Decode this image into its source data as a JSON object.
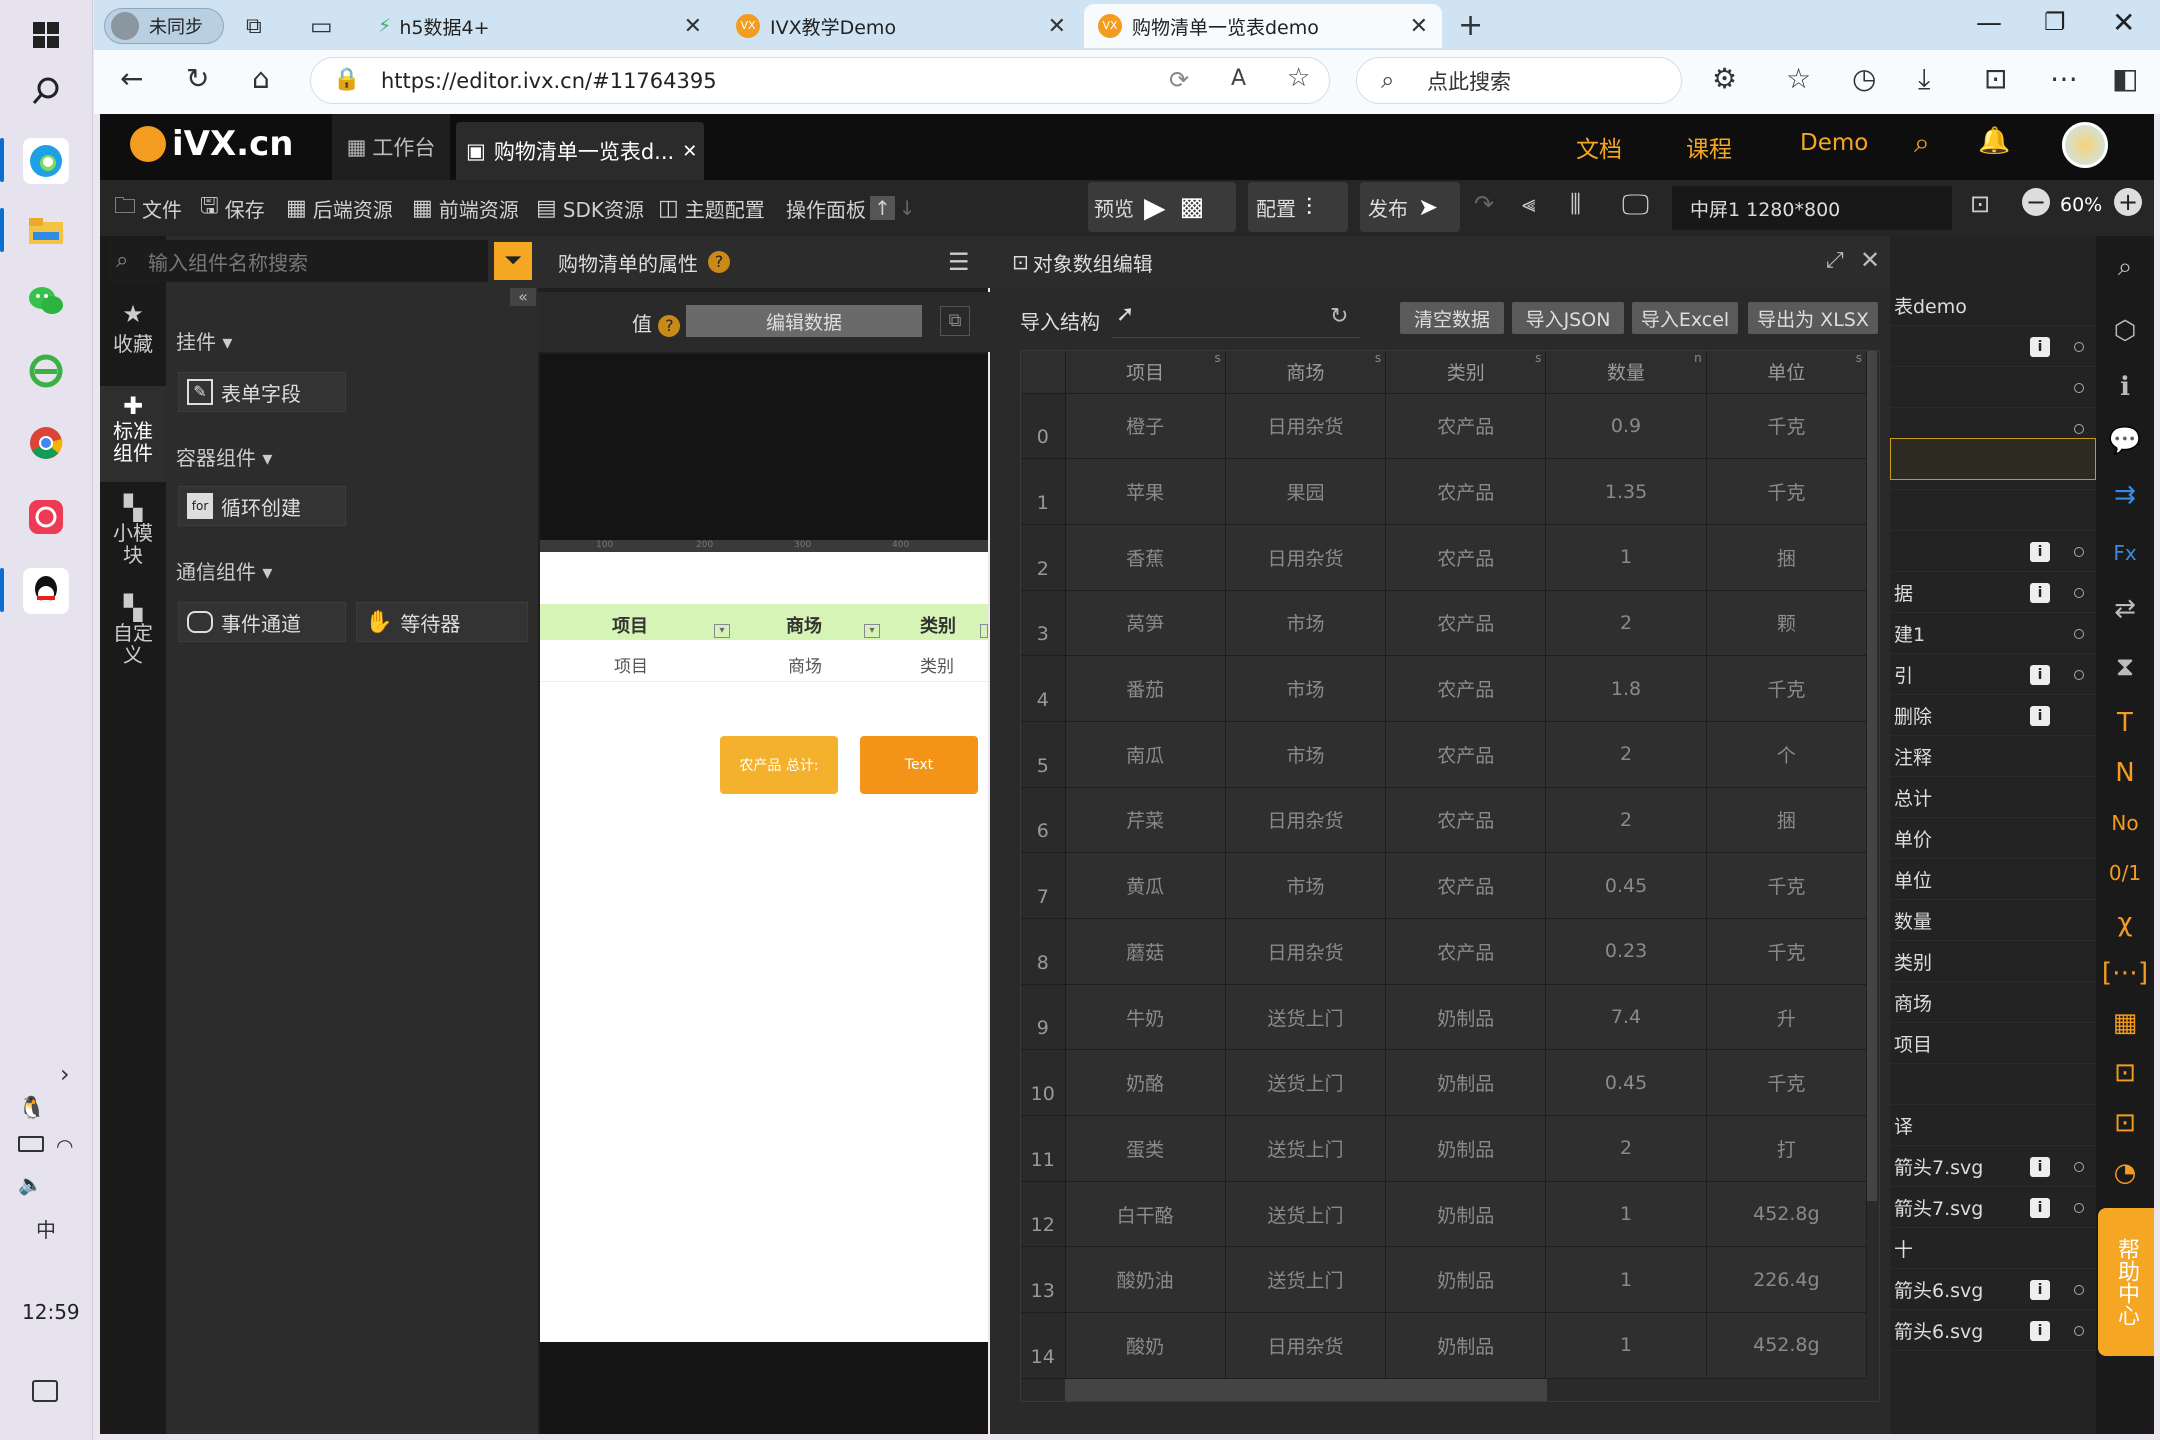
{
  "taskbar": {
    "time": "12:59",
    "ime": "中"
  },
  "browser": {
    "profile": "未同步",
    "tabs": [
      {
        "label": "h5数据4+"
      },
      {
        "label": "IVX教学Demo"
      },
      {
        "label": "购物清单一览表demo"
      }
    ],
    "url": "https://editor.ivx.cn/#11764395",
    "search_placeholder": "点此搜索"
  },
  "app": {
    "logo": "iVX.cn",
    "workbench": "工作台",
    "doc_tab": "购物清单一览表d...",
    "links": [
      "文档",
      "课程",
      "Demo"
    ],
    "toolbar": {
      "file": "文件",
      "save": "保存",
      "backend": "后端资源",
      "frontend": "前端资源",
      "sdk": "SDK资源",
      "theme": "主题配置",
      "ops": "操作面板",
      "preview": "预览",
      "config": "配置",
      "publish": "发布",
      "screen": "中屏1 1280*800",
      "zoom": "60%"
    },
    "left_nav": [
      {
        "label": "收藏"
      },
      {
        "label": "标准组件"
      },
      {
        "label": "小模块"
      },
      {
        "label": "自定义"
      }
    ],
    "component_search_placeholder": "输入组件名称搜索",
    "groups": [
      {
        "title": "挂件",
        "items": [
          "表单字段"
        ]
      },
      {
        "title": "容器组件",
        "items": [
          "循环创建"
        ]
      },
      {
        "title": "通信组件",
        "items": [
          "事件通道",
          "等待器"
        ]
      }
    ],
    "props": {
      "title": "购物清单的属性",
      "value_label": "值",
      "edit_btn": "编辑数据"
    },
    "canvas": {
      "headers": [
        "项目",
        "商场",
        "类别"
      ],
      "row": [
        "项目",
        "商场",
        "类别"
      ],
      "btn1": "农产品 总计:",
      "btn2": "Text",
      "ruler": [
        "100",
        "200",
        "300",
        "400"
      ]
    },
    "data_editor": {
      "title": "对象数组编辑",
      "import_struct": "导入结构",
      "buttons": [
        "清空数据",
        "导入JSON",
        "导入Excel",
        "导出为 XLSX"
      ],
      "columns": [
        {
          "name": "项目",
          "type": "s"
        },
        {
          "name": "商场",
          "type": "s"
        },
        {
          "name": "类别",
          "type": "s"
        },
        {
          "name": "数量",
          "type": "n"
        },
        {
          "name": "单位",
          "type": "s"
        }
      ],
      "rows": [
        [
          "0",
          "橙子",
          "日用杂货",
          "农产品",
          "0.9",
          "千克"
        ],
        [
          "1",
          "苹果",
          "果园",
          "农产品",
          "1.35",
          "千克"
        ],
        [
          "2",
          "香蕉",
          "日用杂货",
          "农产品",
          "1",
          "捆"
        ],
        [
          "3",
          "莴笋",
          "市场",
          "农产品",
          "2",
          "颗"
        ],
        [
          "4",
          "番茄",
          "市场",
          "农产品",
          "1.8",
          "千克"
        ],
        [
          "5",
          "南瓜",
          "市场",
          "农产品",
          "2",
          "个"
        ],
        [
          "6",
          "芹菜",
          "日用杂货",
          "农产品",
          "2",
          "捆"
        ],
        [
          "7",
          "黄瓜",
          "市场",
          "农产品",
          "0.45",
          "千克"
        ],
        [
          "8",
          "蘑菇",
          "日用杂货",
          "农产品",
          "0.23",
          "千克"
        ],
        [
          "9",
          "牛奶",
          "送货上门",
          "奶制品",
          "7.4",
          "升"
        ],
        [
          "10",
          "奶酪",
          "送货上门",
          "奶制品",
          "0.45",
          "千克"
        ],
        [
          "11",
          "蛋类",
          "送货上门",
          "奶制品",
          "2",
          "打"
        ],
        [
          "12",
          "白干酪",
          "送货上门",
          "奶制品",
          "1",
          "452.8g"
        ],
        [
          "13",
          "酸奶油",
          "送货上门",
          "奶制品",
          "1",
          "226.4g"
        ],
        [
          "14",
          "酸奶",
          "日用杂货",
          "奶制品",
          "1",
          "452.8g"
        ]
      ]
    },
    "tree": [
      "表demo",
      "",
      "",
      "",
      "",
      "",
      "",
      "据",
      "建1",
      "引",
      "删除",
      "注释",
      "总计",
      "单价",
      "单位",
      "数量",
      "类别",
      "商场",
      "项目",
      "",
      "译",
      "箭头7.svg",
      "箭头7.svg",
      "十",
      "箭头6.svg",
      "箭头6.svg"
    ],
    "help": "帮助中心"
  }
}
